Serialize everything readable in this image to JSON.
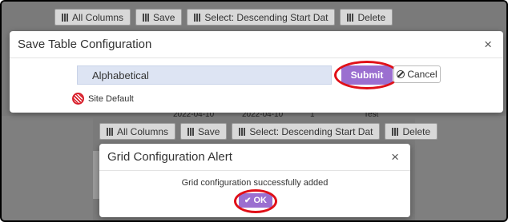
{
  "top": {
    "toolbar": [
      {
        "label": "All Columns",
        "icon": "column-grip-icon"
      },
      {
        "label": "Save",
        "icon": "column-grip-icon"
      },
      {
        "label": "Select: Descending Start Dat",
        "icon": "column-grip-icon"
      },
      {
        "label": "Delete",
        "icon": "column-grip-icon"
      }
    ],
    "dialog": {
      "title": "Save Table Configuration",
      "close": "×",
      "input_value": "Alphabetical",
      "submit_label": "Submit",
      "cancel_label": "Cancel",
      "site_default_label": "Site Default"
    },
    "peek_row": [
      "2022-04-10",
      "2022-04-10",
      "1",
      "Test"
    ]
  },
  "bottom": {
    "toolbar": [
      {
        "label": "All Columns",
        "icon": "column-grip-icon"
      },
      {
        "label": "Save",
        "icon": "column-grip-icon"
      },
      {
        "label": "Select: Descending Start Dat",
        "icon": "column-grip-icon"
      },
      {
        "label": "Delete",
        "icon": "column-grip-icon"
      }
    ],
    "alert": {
      "title": "Grid Configuration Alert",
      "close": "×",
      "message": "Grid configuration successfully added",
      "ok_label": "OK"
    }
  },
  "colors": {
    "accent_purple": "#9b6fd0",
    "highlight_red": "#e01018",
    "overlay_gray": "#7a7a7a"
  }
}
